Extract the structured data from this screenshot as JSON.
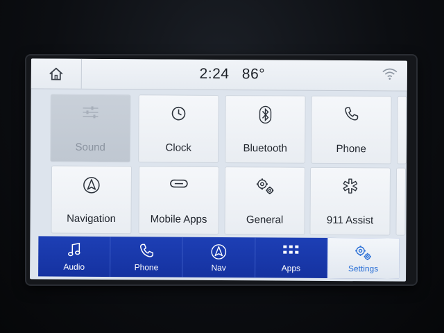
{
  "status": {
    "time": "2:24",
    "temperature": "86°"
  },
  "tiles": [
    {
      "label": "Sound",
      "icon": "sliders-icon",
      "selected": true
    },
    {
      "label": "Clock",
      "icon": "clock-icon"
    },
    {
      "label": "Bluetooth",
      "icon": "bluetooth-icon"
    },
    {
      "label": "Phone",
      "icon": "phone-icon"
    },
    {
      "label": "Navigation",
      "icon": "navigation-icon"
    },
    {
      "label": "Mobile Apps",
      "icon": "link-icon"
    },
    {
      "label": "General",
      "icon": "gears-icon"
    },
    {
      "label": "911 Assist",
      "icon": "star-of-life-icon"
    }
  ],
  "pagination": {
    "count": 2,
    "active": 1
  },
  "nav": [
    {
      "label": "Audio",
      "icon": "music-note-icon"
    },
    {
      "label": "Phone",
      "icon": "phone-icon"
    },
    {
      "label": "Nav",
      "icon": "navigation-icon"
    },
    {
      "label": "Apps",
      "icon": "apps-grid-icon"
    },
    {
      "label": "Settings",
      "icon": "gears-icon",
      "active": true
    }
  ],
  "colors": {
    "nav_bar": "#1a38ab",
    "active_accent": "#2a6fd6",
    "screen_bg": "#dde4ed"
  }
}
